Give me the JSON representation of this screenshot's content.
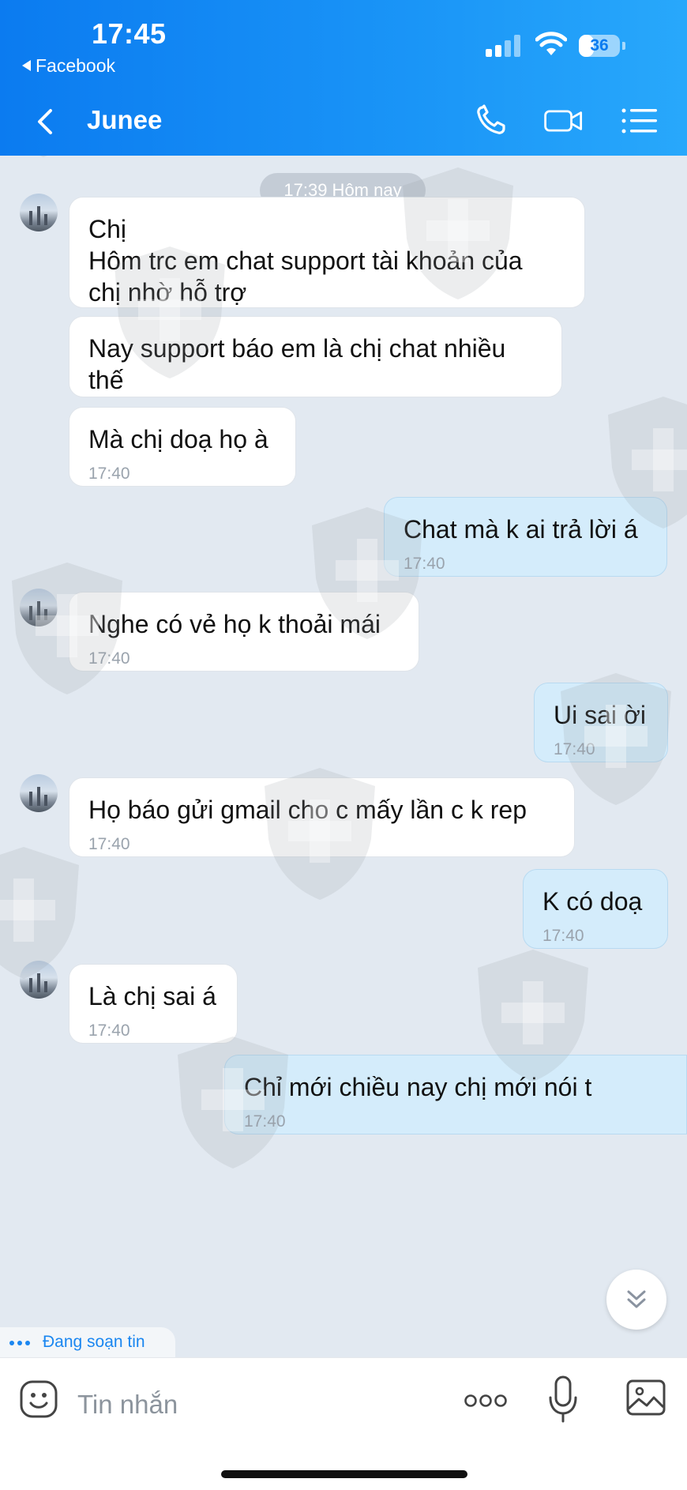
{
  "status_bar": {
    "time": "17:45",
    "back_app": "Facebook",
    "battery": "36",
    "battery_level_pct": 36
  },
  "header": {
    "contact_name": "Junee",
    "icons": [
      "back-icon",
      "phone-icon",
      "video-call-icon",
      "menu-list-icon"
    ]
  },
  "chat": {
    "date_separator": "17:39 Hôm nay",
    "messages": [
      {
        "dir": "in",
        "avatar": true,
        "lines": [
          "Chị",
          "Hôm trc em chat support tài khoản của",
          "chị nhờ hỗ trợ"
        ],
        "time": ""
      },
      {
        "dir": "in",
        "avatar": false,
        "lines": [
          "Nay support báo em là chị chat nhiều",
          "thế"
        ],
        "time": ""
      },
      {
        "dir": "in",
        "avatar": false,
        "lines": [
          "Mà chị doạ họ à"
        ],
        "time": "17:40"
      },
      {
        "dir": "out",
        "lines": [
          "Chat mà k ai trả lời á"
        ],
        "time": "17:40"
      },
      {
        "dir": "in",
        "avatar": true,
        "lines": [
          "Nghe có vẻ họ k thoải mái"
        ],
        "time": "17:40"
      },
      {
        "dir": "out",
        "lines": [
          "Ui sai ời"
        ],
        "time": "17:40"
      },
      {
        "dir": "in",
        "avatar": true,
        "lines": [
          "Họ báo gửi gmail cho c mấy lần c k rep"
        ],
        "time": "17:40"
      },
      {
        "dir": "out",
        "lines": [
          "K có doạ"
        ],
        "time": "17:40"
      },
      {
        "dir": "in",
        "avatar": true,
        "lines": [
          "Là chị sai á"
        ],
        "time": "17:40"
      },
      {
        "dir": "out",
        "lines": [
          "Chỉ mới chiều nay chị mới nói t"
        ],
        "time": "17:40"
      }
    ],
    "typing_indicator": "Đang soạn tin",
    "scroll_down_icon": "double-chevron-down-icon"
  },
  "composer": {
    "placeholder": "Tin nhắn",
    "icons": [
      "emoji-icon",
      "more-icon",
      "microphone-icon",
      "image-icon"
    ]
  },
  "colors": {
    "header_blue": "#1a95f7",
    "incoming_bubble": "#ffffff",
    "outgoing_bubble": "#d4ecfb",
    "chat_background": "#e2e9f1"
  }
}
